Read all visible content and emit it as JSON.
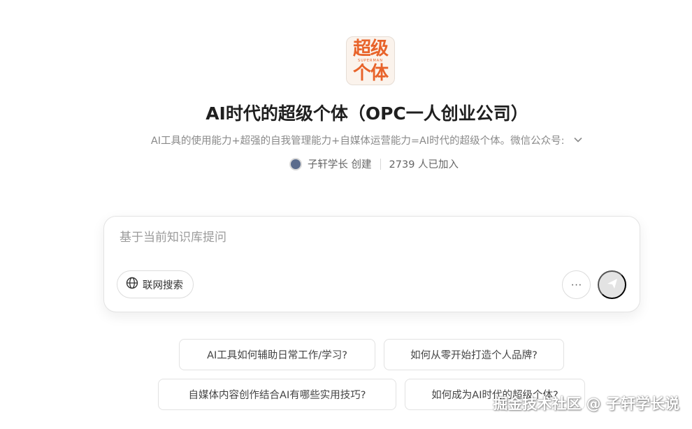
{
  "logo": {
    "line1": "超级",
    "sub": "SUPERMAN",
    "line2": "个体"
  },
  "header": {
    "title": "AI时代的超级个体（OPC一人创业公司）",
    "subtitle": "AI工具的使用能力+超强的自我管理能力+自媒体运营能力=AI时代的超级个体。微信公众号:",
    "creator_name": "子轩学长 创建",
    "members": "2739 人已加入"
  },
  "ask": {
    "placeholder": "基于当前知识库提问",
    "web_search_label": "联网搜索",
    "more_label": "···"
  },
  "suggestions": [
    "AI工具如何辅助日常工作/学习?",
    "如何从零开始打造个人品牌?",
    "自媒体内容创作结合AI有哪些实用技巧?",
    "如何成为AI时代的超级个体?"
  ],
  "watermark": "掘金技术社区 @ 子轩学长说",
  "colors": {
    "brand": "#e8632a",
    "send_disabled": "#e3e3e3"
  }
}
